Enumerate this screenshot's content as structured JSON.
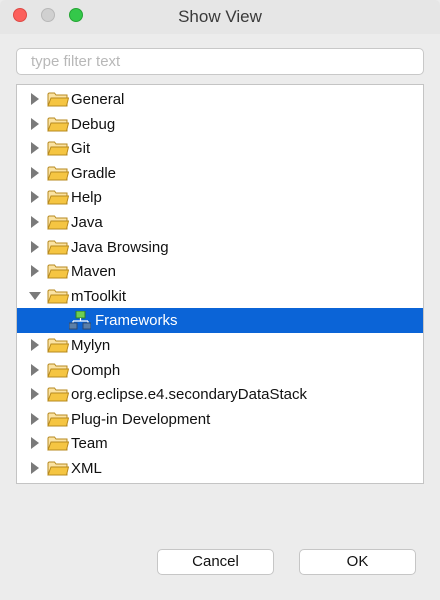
{
  "window": {
    "title": "Show View"
  },
  "filter": {
    "placeholder": "type filter text",
    "value": ""
  },
  "tree": {
    "items": [
      {
        "label": "General",
        "expanded": false
      },
      {
        "label": "Debug",
        "expanded": false
      },
      {
        "label": "Git",
        "expanded": false
      },
      {
        "label": "Gradle",
        "expanded": false
      },
      {
        "label": "Help",
        "expanded": false
      },
      {
        "label": "Java",
        "expanded": false
      },
      {
        "label": "Java Browsing",
        "expanded": false
      },
      {
        "label": "Maven",
        "expanded": false
      },
      {
        "label": "mToolkit",
        "expanded": true
      },
      {
        "label": "Frameworks",
        "child": true,
        "selected": true
      },
      {
        "label": "Mylyn",
        "expanded": false
      },
      {
        "label": "Oomph",
        "expanded": false
      },
      {
        "label": "org.eclipse.e4.secondaryDataStack",
        "expanded": false
      },
      {
        "label": "Plug-in Development",
        "expanded": false
      },
      {
        "label": "Team",
        "expanded": false
      },
      {
        "label": "XML",
        "expanded": false
      }
    ]
  },
  "buttons": {
    "cancel": "Cancel",
    "ok": "OK"
  },
  "colors": {
    "selection": "#0b64d7",
    "folder": "#f5c542"
  }
}
